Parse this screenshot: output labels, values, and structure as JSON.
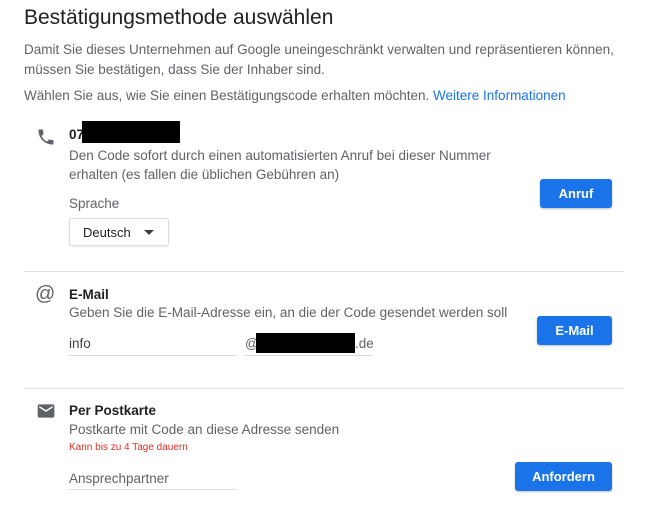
{
  "header": {
    "title": "Bestätigungsmethode auswählen",
    "intro": "Damit Sie dieses Unternehmen auf Google uneingeschränkt verwalten und repräsentieren können, müssen Sie bestätigen, dass Sie der Inhaber sind.",
    "choose_text": "Wählen Sie aus, wie Sie einen Bestätigungscode erhalten möchten.",
    "more_info_link": "Weitere Informationen"
  },
  "call_option": {
    "icon": "phone-icon",
    "phone_prefix": "07",
    "description": "Den Code sofort durch einen automatisierten Anruf bei dieser Nummer erhalten (es fallen die üblichen Gebühren an)",
    "language_label": "Sprache",
    "language_value": "Deutsch",
    "button_label": "Anruf"
  },
  "email_option": {
    "icon": "at-icon",
    "title": "E-Mail",
    "description": "Geben Sie die E-Mail-Adresse ein, an die der Code gesendet werden soll",
    "local_part": "info",
    "at_sign": "@",
    "domain_suffix": ".de",
    "button_label": "E-Mail"
  },
  "postcard_option": {
    "icon": "mail-envelope-icon",
    "title": "Per Postkarte",
    "description": "Postkarte mit Code an diese Adresse senden",
    "warning": "Kann bis zu 4 Tage dauern",
    "contact_placeholder": "Ansprechpartner",
    "button_label": "Anfordern"
  },
  "colors": {
    "accent": "#1a73e8",
    "warning": "#d93025",
    "text": "#3c4043",
    "divider": "#e0e0e0"
  }
}
